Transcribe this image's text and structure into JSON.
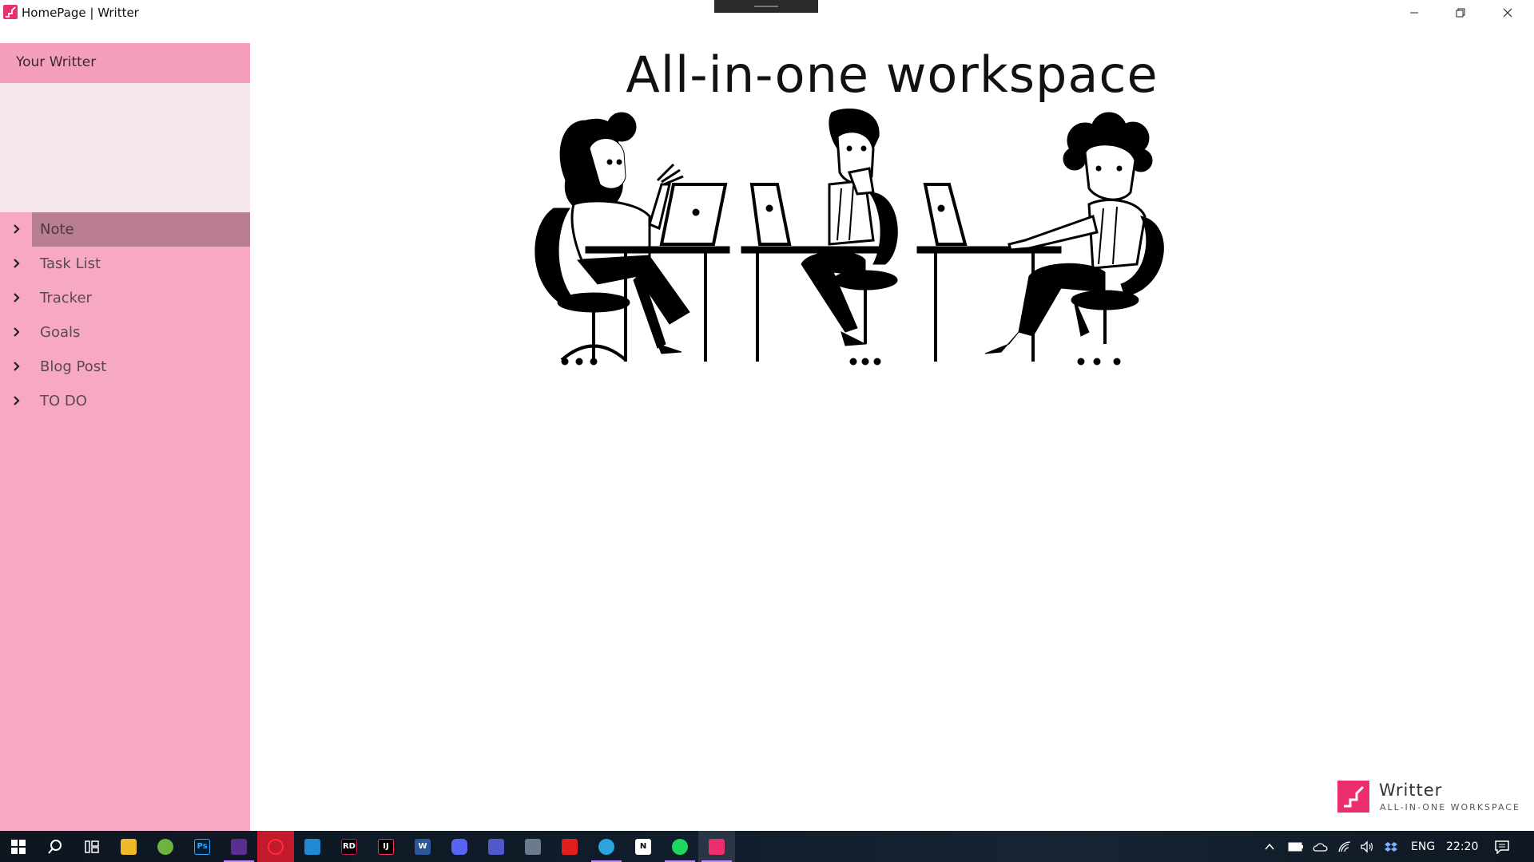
{
  "window": {
    "title": "HomePage | Writter"
  },
  "sidebar": {
    "header": "Your Writter",
    "items": [
      {
        "label": "Note",
        "selected": true
      },
      {
        "label": "Task List",
        "selected": false
      },
      {
        "label": "Tracker",
        "selected": false
      },
      {
        "label": "Goals",
        "selected": false
      },
      {
        "label": "Blog Post",
        "selected": false
      },
      {
        "label": "TO DO",
        "selected": false
      }
    ]
  },
  "main": {
    "headline": "All-in-one workspace"
  },
  "brand": {
    "name": "Writter",
    "tagline": "ALL-IN-ONE WORKSPACE"
  },
  "taskbar": {
    "apps": [
      {
        "name": "start-icon"
      },
      {
        "name": "search-icon"
      },
      {
        "name": "task-view-icon"
      },
      {
        "name": "file-explorer-icon"
      },
      {
        "name": "utorrent-icon"
      },
      {
        "name": "photoshop-icon",
        "text": "Ps"
      },
      {
        "name": "visual-studio-icon"
      },
      {
        "name": "opera-icon"
      },
      {
        "name": "vscode-icon"
      },
      {
        "name": "rider-icon",
        "text": "RD"
      },
      {
        "name": "intellij-icon",
        "text": "IJ"
      },
      {
        "name": "word-icon",
        "text": "W"
      },
      {
        "name": "discord-icon"
      },
      {
        "name": "teams-icon"
      },
      {
        "name": "calculator-icon"
      },
      {
        "name": "acrobat-icon"
      },
      {
        "name": "telegram-icon"
      },
      {
        "name": "notion-icon",
        "text": "N"
      },
      {
        "name": "spotify-icon"
      },
      {
        "name": "writter-icon"
      }
    ],
    "tray": {
      "language": "ENG",
      "time": "22:20"
    }
  },
  "colors": {
    "sidebar_bg": "#f7a8c5",
    "sidebar_header_bg": "#f49ebb",
    "sidebar_blank_bg": "#f5e7ea",
    "selected_item_bg": "#b97e92",
    "brand_accent": "#ea2f6c"
  }
}
